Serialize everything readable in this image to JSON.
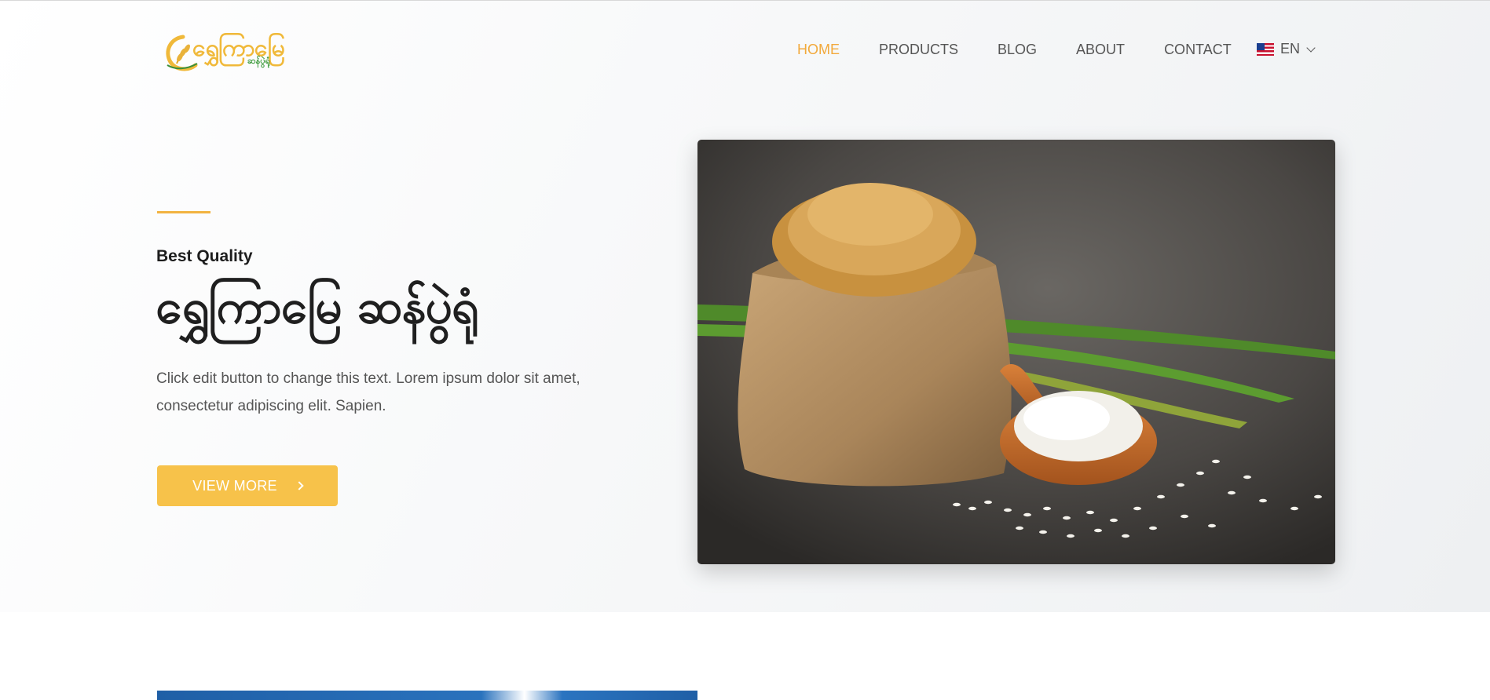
{
  "brand": {
    "logo_text": "ရွှေကြာမြေ",
    "logo_subtext": "ဆန်ပွဲရုံ"
  },
  "nav": {
    "items": [
      {
        "label": "HOME",
        "active": true
      },
      {
        "label": "PRODUCTS",
        "active": false
      },
      {
        "label": "BLOG",
        "active": false
      },
      {
        "label": "ABOUT",
        "active": false
      },
      {
        "label": "CONTACT",
        "active": false
      }
    ],
    "language": {
      "label": "EN",
      "flag_icon": "us-flag-icon"
    }
  },
  "hero": {
    "eyebrow": "Best Quality",
    "title": "ရွှေကြာမြေ ဆန်ပွဲရုံ",
    "text": "Click edit button to change this text. Lorem ipsum dolor sit amet, consectetur adipiscing elit. Sapien.",
    "cta_label": "VIEW MORE"
  },
  "colors": {
    "accent": "#f7c24a",
    "nav_active": "#f2a93b",
    "text_dark": "#1f1f1f",
    "text_muted": "#555555"
  }
}
